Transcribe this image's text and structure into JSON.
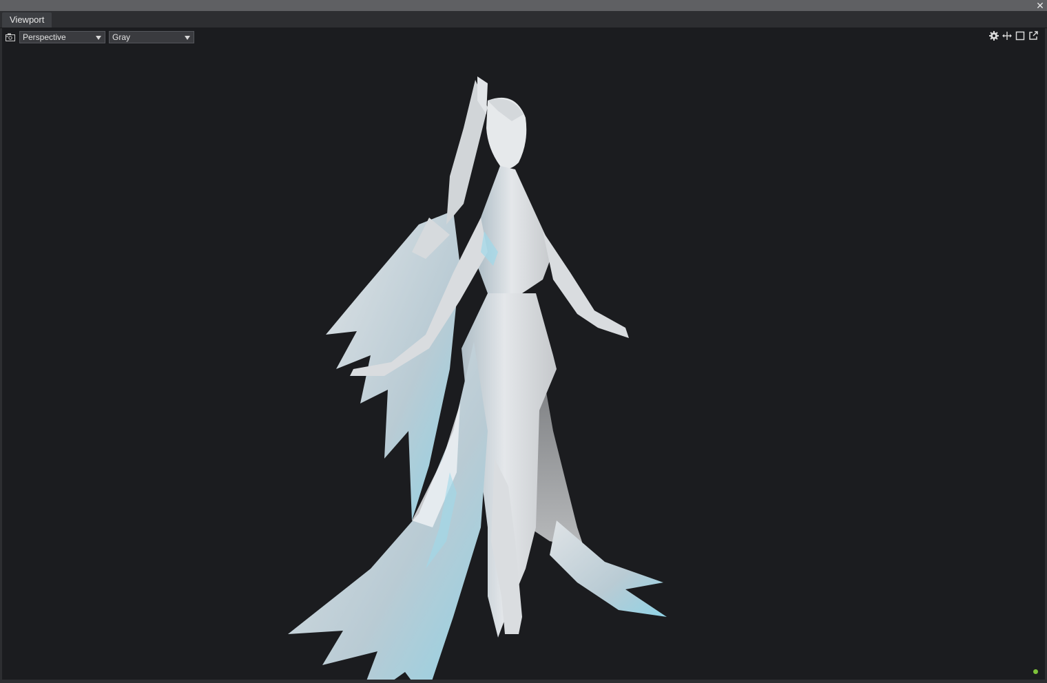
{
  "window": {
    "close_glyph": "✕"
  },
  "tabs": [
    {
      "label": "Viewport",
      "active": true
    }
  ],
  "viewport": {
    "camera_select": {
      "value": "Perspective"
    },
    "shading_select": {
      "value": "Gray"
    },
    "icons": {
      "camera": "camera-icon",
      "settings": "gear-icon",
      "move": "move-arrows-icon",
      "maximize": "square-maximize-icon",
      "popout": "popout-icon"
    },
    "status_color": "#7ec23a",
    "background_color": "#1b1c1f",
    "model_color": "#dfe3e6",
    "rim_light_color": "#7fd6ea"
  }
}
